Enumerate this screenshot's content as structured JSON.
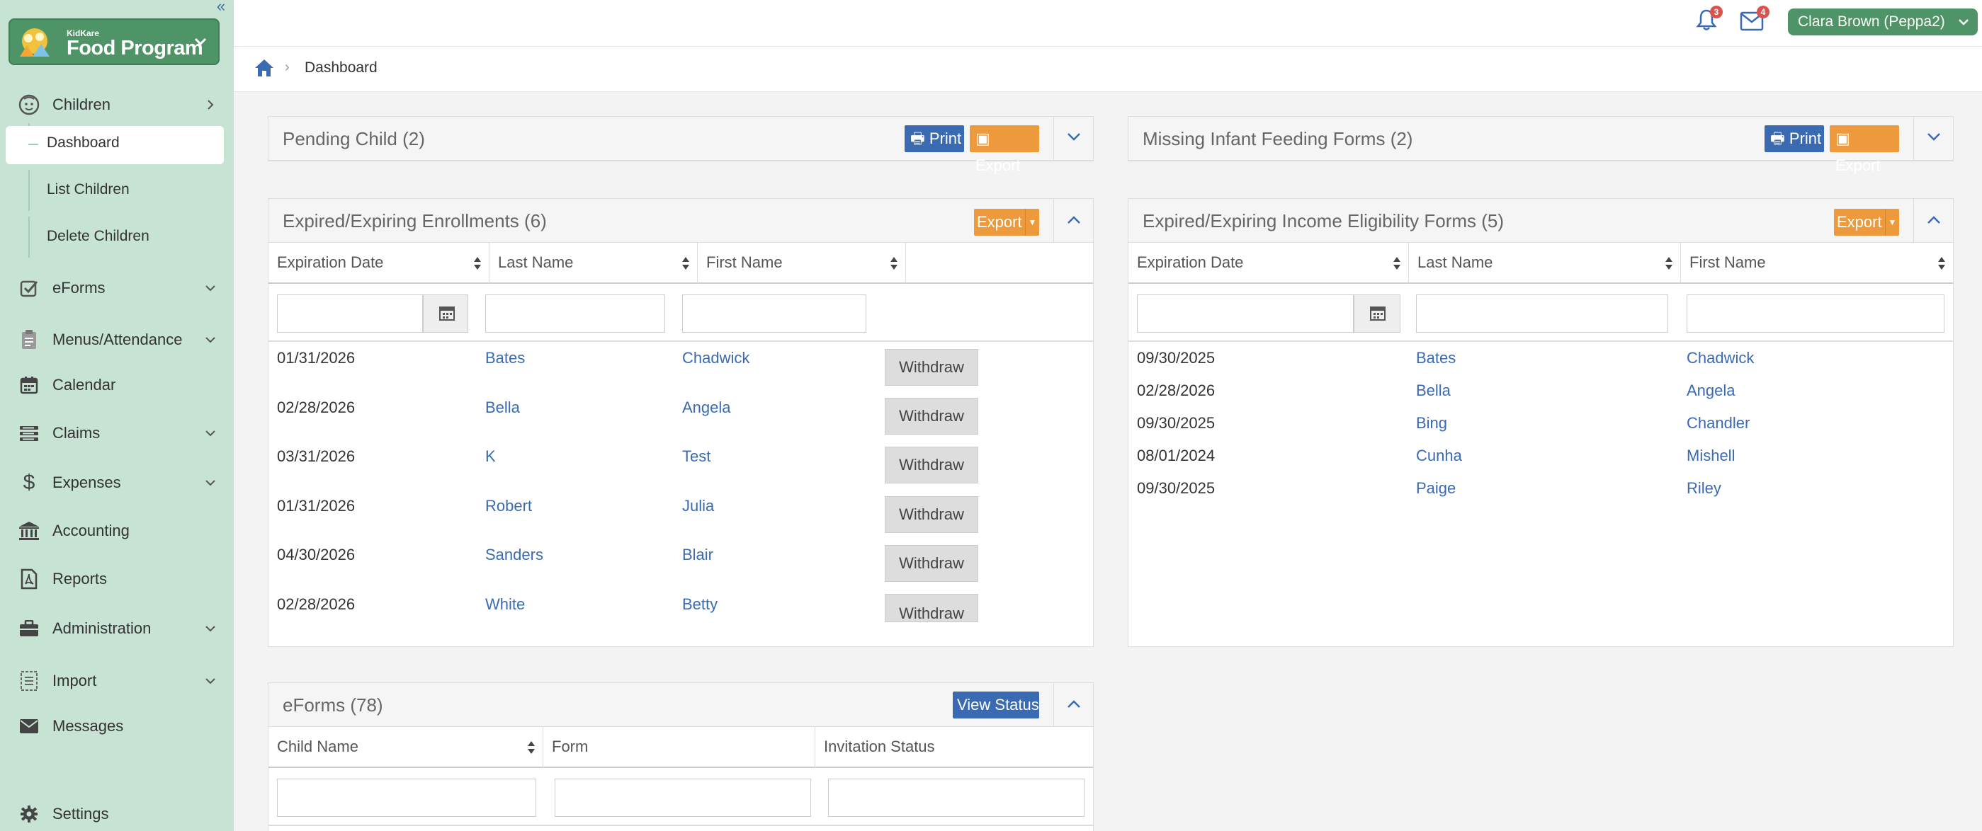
{
  "brand": {
    "small": "KidKare",
    "name": "Food Program"
  },
  "sidebar": {
    "items": [
      {
        "label": "Children",
        "icon": "child-face-icon"
      },
      {
        "label": "eForms",
        "icon": "check-square-icon"
      },
      {
        "label": "Menus/Attendance",
        "icon": "clipboard-icon"
      },
      {
        "label": "Calendar",
        "icon": "calendar-icon"
      },
      {
        "label": "Claims",
        "icon": "list-icon"
      },
      {
        "label": "Expenses",
        "icon": "dollar-icon"
      },
      {
        "label": "Accounting",
        "icon": "bank-icon"
      },
      {
        "label": "Reports",
        "icon": "pdf-file-icon"
      },
      {
        "label": "Administration",
        "icon": "briefcase-icon"
      },
      {
        "label": "Import",
        "icon": "import-icon"
      },
      {
        "label": "Messages",
        "icon": "envelope-icon"
      },
      {
        "label": "Settings",
        "icon": "gear-icon"
      }
    ],
    "children_sub": [
      "Dashboard",
      "List Children",
      "Delete Children"
    ]
  },
  "topbar": {
    "notifications_count": "3",
    "messages_count": "4",
    "user": "Clara Brown (Peppa2)"
  },
  "breadcrumb": {
    "current": "Dashboard"
  },
  "panels": {
    "pending": {
      "title": "Pending Child (2)",
      "print": "Print",
      "export": "Export"
    },
    "missing": {
      "title": "Missing Infant Feeding Forms (2)",
      "print": "Print",
      "export": "Export"
    },
    "enrollments": {
      "title": "Expired/Expiring Enrollments (6)",
      "export": "Export",
      "columns": [
        "Expiration Date",
        "Last Name",
        "First Name"
      ],
      "action": "Withdraw",
      "rows": [
        [
          "01/31/2026",
          "Bates",
          "Chadwick"
        ],
        [
          "02/28/2026",
          "Bella",
          "Angela"
        ],
        [
          "03/31/2026",
          "K",
          "Test"
        ],
        [
          "01/31/2026",
          "Robert",
          "Julia"
        ],
        [
          "04/30/2026",
          "Sanders",
          "Blair"
        ],
        [
          "02/28/2026",
          "White",
          "Betty"
        ]
      ]
    },
    "income": {
      "title": "Expired/Expiring Income Eligibility Forms (5)",
      "export": "Export",
      "columns": [
        "Expiration Date",
        "Last Name",
        "First Name"
      ],
      "rows": [
        [
          "09/30/2025",
          "Bates",
          "Chadwick"
        ],
        [
          "02/28/2026",
          "Bella",
          "Angela"
        ],
        [
          "09/30/2025",
          "Bing",
          "Chandler"
        ],
        [
          "08/01/2024",
          "Cunha",
          "Mishell"
        ],
        [
          "09/30/2025",
          "Paige",
          "Riley"
        ]
      ]
    },
    "eforms": {
      "title": "eForms (78)",
      "view_status": "View Status",
      "columns": [
        "Child Name",
        "Form",
        "Invitation Status"
      ]
    }
  }
}
